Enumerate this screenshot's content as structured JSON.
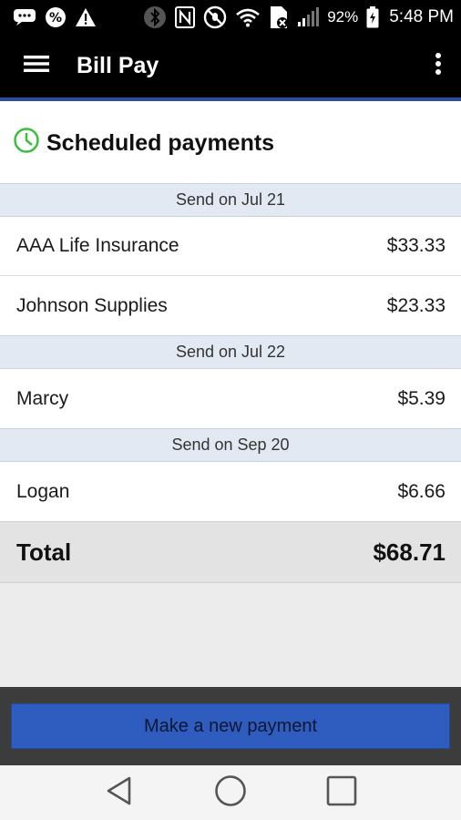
{
  "status_bar": {
    "battery_percent": "92%",
    "time": "5:48 PM",
    "icons": [
      "chat-bubble-icon",
      "percent-icon",
      "warning-icon",
      "bluetooth-icon",
      "nfc-icon",
      "mute-icon",
      "wifi-icon",
      "sim-icon",
      "signal-icon",
      "battery-icon"
    ]
  },
  "app_bar": {
    "title": "Bill Pay",
    "menu_icon": "hamburger-menu-icon",
    "overflow_icon": "more-vert-icon"
  },
  "section": {
    "title": "Scheduled payments",
    "icon": "clock-icon",
    "icon_color": "#3bbf3b"
  },
  "groups": [
    {
      "date_label": "Send on Jul 21",
      "payments": [
        {
          "payee": "AAA Life Insurance",
          "amount": "$33.33"
        },
        {
          "payee": "Johnson Supplies",
          "amount": "$23.33"
        }
      ]
    },
    {
      "date_label": "Send on Jul 22",
      "payments": [
        {
          "payee": "Marcy",
          "amount": "$5.39"
        }
      ]
    },
    {
      "date_label": "Send on Sep 20",
      "payments": [
        {
          "payee": "Logan",
          "amount": "$6.66"
        }
      ]
    }
  ],
  "total": {
    "label": "Total",
    "amount": "$68.71"
  },
  "action": {
    "label": "Make a new payment",
    "color": "#2f5cbf"
  },
  "nav_bar": {
    "buttons": [
      "back-icon",
      "home-icon",
      "recents-icon"
    ]
  }
}
